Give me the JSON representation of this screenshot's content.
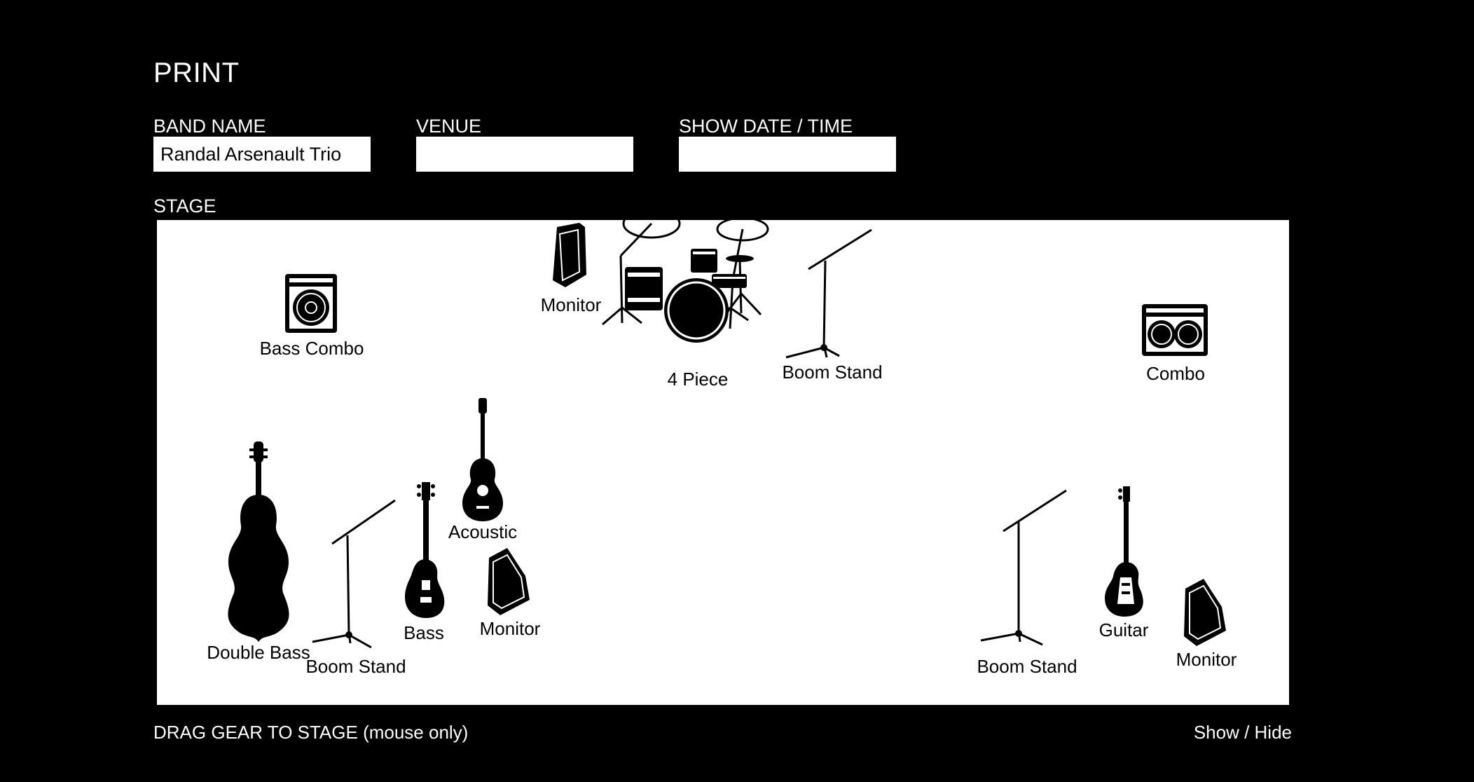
{
  "header": {
    "print_label": "PRINT"
  },
  "form": {
    "band_name": {
      "label": "BAND NAME",
      "value": "Randal Arsenault Trio"
    },
    "venue": {
      "label": "VENUE",
      "value": ""
    },
    "show_date": {
      "label": "SHOW DATE / TIME",
      "value": ""
    }
  },
  "stage": {
    "label": "STAGE",
    "items": {
      "monitor_top": "Monitor",
      "drums": "4 Piece",
      "boom_stand_top": "Boom Stand",
      "bass_combo": "Bass Combo",
      "combo": "Combo",
      "acoustic": "Acoustic",
      "double_bass": "Double Bass",
      "boom_stand_left": "Boom Stand",
      "bass": "Bass",
      "monitor_left": "Monitor",
      "boom_stand_right": "Boom Stand",
      "guitar": "Guitar",
      "monitor_right": "Monitor"
    }
  },
  "footer": {
    "drag_note": "DRAG GEAR TO STAGE (mouse only)",
    "toggle_label": "Show / Hide"
  }
}
